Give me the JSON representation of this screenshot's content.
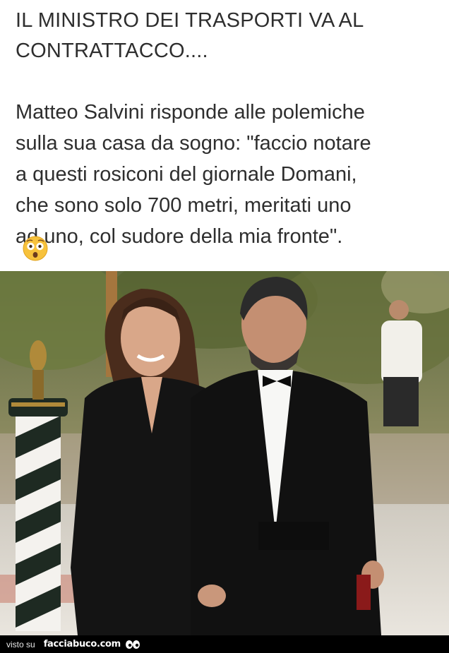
{
  "headline": {
    "line1": "IL MINISTRO DEI TRASPORTI VA AL",
    "line2": "CONTRATTACCO...."
  },
  "body": {
    "lines": [
      "Matteo Salvini risponde alle polemiche",
      "sulla sua casa da sogno: \"faccio notare",
      "a questi rosiconi del giornale Domani,",
      "che sono solo 700 metri, meritati uno",
      "ad uno, col sudore della mia fronte\"."
    ],
    "emoji": "astonished-face-icon"
  },
  "photo": {
    "subjects": "couple-in-black-formal-wear-icon"
  },
  "footer": {
    "prefix": "visto su",
    "site": "facciabuco.com",
    "logo": "eyes-logo-icon"
  },
  "colors": {
    "text": "#2e2e2e",
    "footer_bg": "#000000",
    "footer_text": "#ffffff"
  }
}
